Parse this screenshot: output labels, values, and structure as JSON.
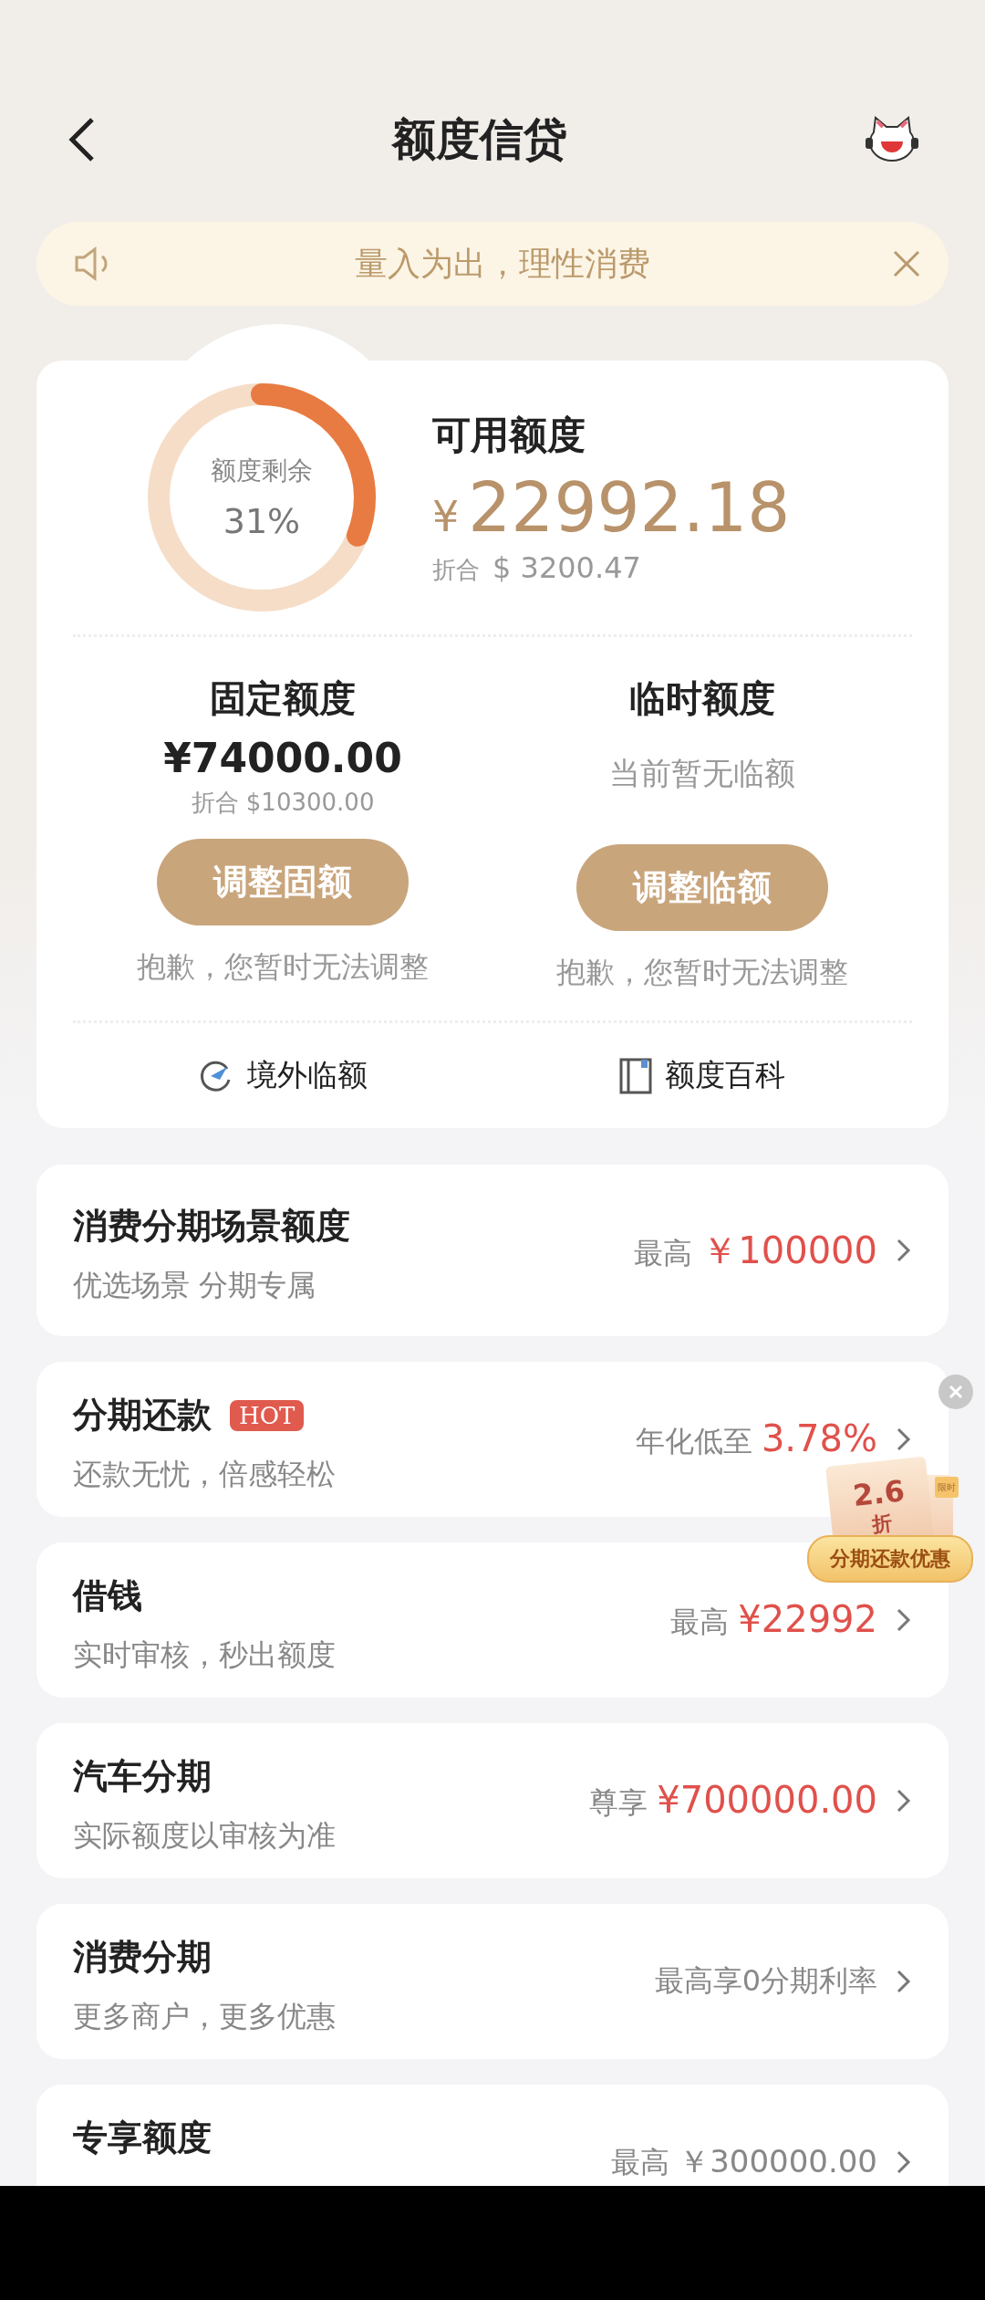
{
  "header": {
    "title": "额度信贷"
  },
  "notice": {
    "text": "量入为出，理性消费"
  },
  "credit": {
    "ring": {
      "label": "额度剩余",
      "reading": "31%",
      "level": 0.31
    },
    "title": "可用额度",
    "currency": "¥",
    "amount": "22992.18",
    "converted_label": "折合",
    "converted": "$ 3200.47",
    "columns": [
      {
        "title": "固定额度",
        "kind": "amount",
        "amount": "¥74000.00",
        "note": "折合 $10300.00",
        "button": "调整固额",
        "disabled_note": "抱歉，您暂时无法调整"
      },
      {
        "title": "临时额度",
        "kind": "empty",
        "note": "当前暂无临额",
        "button": "调整临额",
        "disabled_note": "抱歉，您暂时无法调整"
      }
    ],
    "links": [
      {
        "kind": "plane",
        "label": "境外临额"
      },
      {
        "kind": "book",
        "label": "额度百科"
      }
    ]
  },
  "products": [
    {
      "title": "消费分期场景额度",
      "subtitle": "优选场景 分期专属",
      "note": "最高",
      "amount": "￥100000",
      "emphasis": true
    },
    {
      "title": "分期还款",
      "badge": "HOT",
      "subtitle": "还款无忧，倍感轻松",
      "note": "年化低至",
      "amount": "3.78%",
      "emphasis": true
    },
    {
      "title": "借钱",
      "subtitle": "实时审核，秒出额度",
      "note": "最高",
      "amount": "¥22992",
      "emphasis": true
    },
    {
      "title": "汽车分期",
      "subtitle": "实际额度以审核为准",
      "note": "尊享",
      "amount": "¥700000.00",
      "emphasis": true
    },
    {
      "title": "消费分期",
      "subtitle": "更多商户，更多优惠",
      "note": "最高享0分期利率"
    },
    {
      "title": "专享额度",
      "note": "最高",
      "amount": "￥300000.00",
      "emphasis": false
    }
  ],
  "promo": {
    "discount": "2.6",
    "unit": "折",
    "tag": "限时",
    "label": "分期还款优惠"
  }
}
